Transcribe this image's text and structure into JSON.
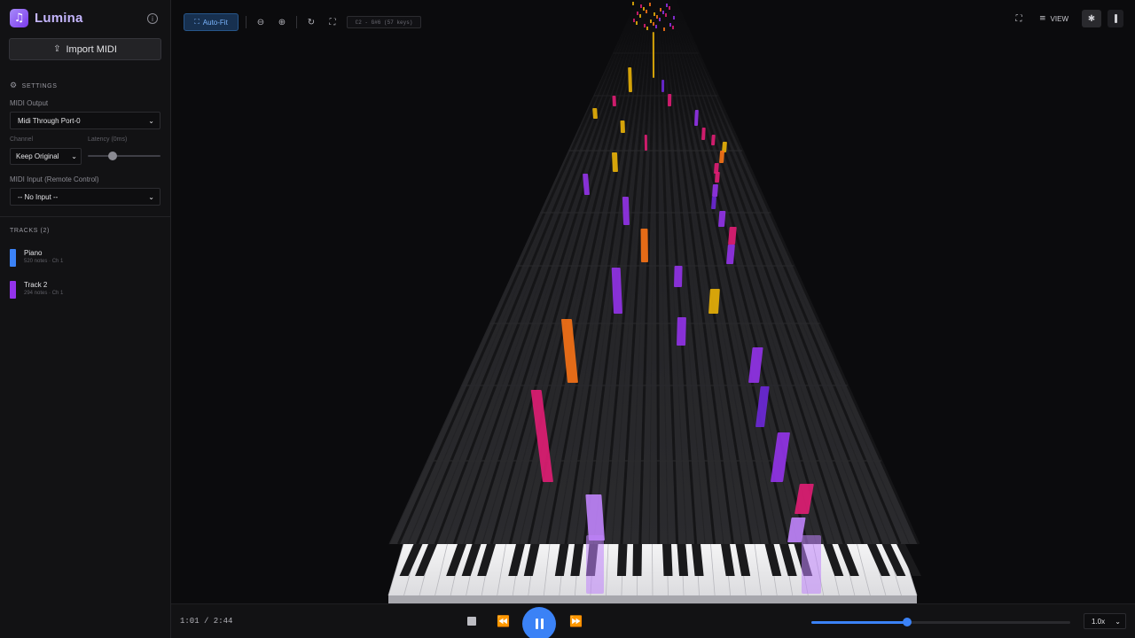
{
  "app": {
    "name": "Lumina"
  },
  "sidebar": {
    "import_label": "Import MIDI",
    "settings_heading": "SETTINGS",
    "midi_output": {
      "label": "MIDI Output",
      "value": "Midi Through Port-0"
    },
    "channel": {
      "label": "Channel",
      "value": "Keep Original"
    },
    "latency": {
      "label": "Latency (0ms)",
      "value": 0
    },
    "midi_input": {
      "label": "MIDI Input (Remote Control)",
      "value": "-- No Input --"
    },
    "tracks_heading": "TRACKS (2)",
    "tracks": [
      {
        "name": "Piano",
        "meta": "520 notes · Ch 1",
        "color": "#3b82f6"
      },
      {
        "name": "Track 2",
        "meta": "294 notes · Ch 1",
        "color": "#9333ea"
      }
    ]
  },
  "toolbar": {
    "autofit_label": "Auto-Fit",
    "range_label": "C2 - G#6 (57 keys)",
    "view_label": "VIEW"
  },
  "transport": {
    "time": "1:01 / 2:44",
    "progress": 0.37,
    "speed": "1.0x"
  },
  "colors": {
    "accent": "#3b82f6",
    "brand": "#a78bfa",
    "note_yellow": "#eab308",
    "note_orange": "#f97316",
    "note_pink": "#e11d74",
    "note_purple": "#9333ea",
    "note_blue": "#6d28d9"
  },
  "icons": {
    "logo": "music-note-icon",
    "info": "info-icon",
    "import": "upload-icon",
    "settings": "gear-icon",
    "zoom_out": "zoom-out-icon",
    "zoom_in": "zoom-in-icon",
    "reset": "refresh-icon",
    "fit": "fit-screen-icon",
    "fullscreen": "fullscreen-icon",
    "view": "sliders-icon",
    "debug": "bug-icon"
  }
}
